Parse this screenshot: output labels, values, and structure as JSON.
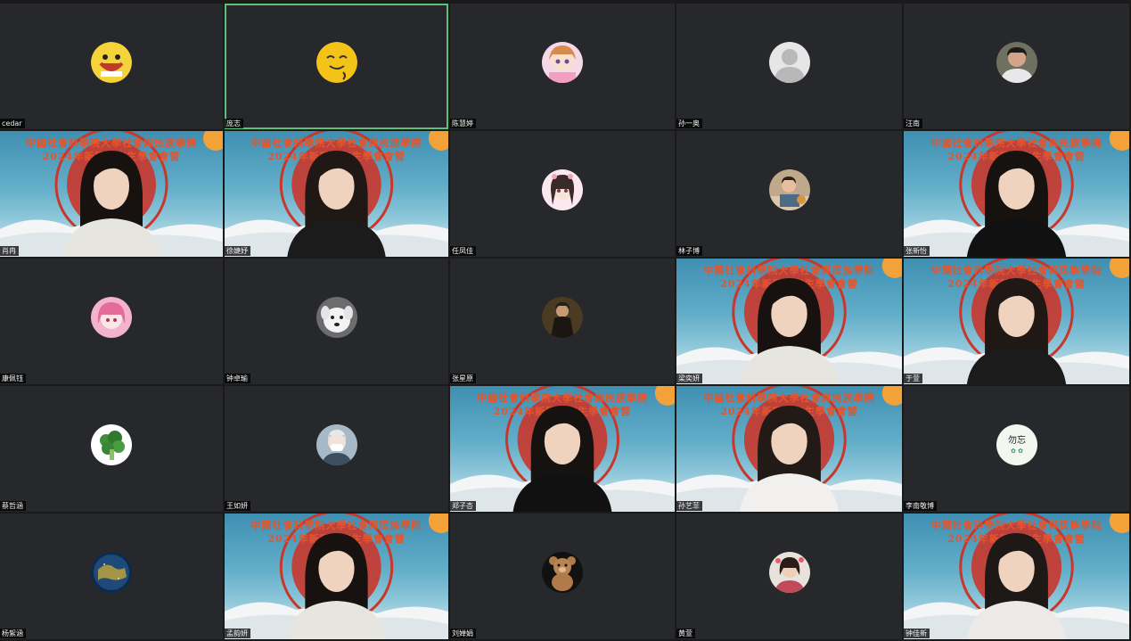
{
  "meeting": {
    "banner_line1": "中國社會科學院大學社會與民族學院",
    "banner_line2": "2024年新聞研究生學會會營",
    "participants": [
      {
        "name": "cedar",
        "type": "avatar",
        "icon": "smile-emoji-avatar-icon"
      },
      {
        "name": "庞志",
        "type": "avatar",
        "icon": "yellow-cartoon-avatar-icon",
        "active": true
      },
      {
        "name": "陈慧婷",
        "type": "avatar",
        "icon": "anime-girl-avatar-icon"
      },
      {
        "name": "孙一奥",
        "type": "avatar",
        "icon": "default-person-avatar-icon"
      },
      {
        "name": "汪南",
        "type": "avatar",
        "icon": "photo-person-avatar-icon"
      },
      {
        "name": "肖冉",
        "type": "video"
      },
      {
        "name": "徐婕妤",
        "type": "video"
      },
      {
        "name": "任凤佳",
        "type": "avatar",
        "icon": "anime-girl-pink-avatar-icon"
      },
      {
        "name": "林子博",
        "type": "avatar",
        "icon": "child-photo-avatar-icon"
      },
      {
        "name": "张新怡",
        "type": "video"
      },
      {
        "name": "康佩钰",
        "type": "avatar",
        "icon": "pink-anime-avatar-icon"
      },
      {
        "name": "钟卓瑜",
        "type": "avatar",
        "icon": "white-dog-avatar-icon"
      },
      {
        "name": "张星原",
        "type": "avatar",
        "icon": "portrait-painting-avatar-icon"
      },
      {
        "name": "梁奕妍",
        "type": "video"
      },
      {
        "name": "于萱",
        "type": "video"
      },
      {
        "name": "蔡哲涵",
        "type": "avatar",
        "icon": "broccoli-avatar-icon"
      },
      {
        "name": "王如妍",
        "type": "avatar",
        "icon": "masked-person-avatar-icon"
      },
      {
        "name": "郑子杏",
        "type": "video"
      },
      {
        "name": "孙艺菲",
        "type": "video"
      },
      {
        "name": "李南敬博",
        "type": "avatar",
        "icon": "handwriting-avatar-icon"
      },
      {
        "name": "杨絮涵",
        "type": "avatar",
        "icon": "earth-night-avatar-icon"
      },
      {
        "name": "孟韵妍",
        "type": "video"
      },
      {
        "name": "刘婵娟",
        "type": "avatar",
        "icon": "teddy-bear-avatar-icon"
      },
      {
        "name": "黄萱",
        "type": "avatar",
        "icon": "girl-photo-avatar-icon"
      },
      {
        "name": "钟佳新",
        "type": "video"
      }
    ]
  },
  "colors": {
    "tile_bg": "#26282b",
    "active_border": "#5fbf7a",
    "banner_red": "#e3552e"
  }
}
